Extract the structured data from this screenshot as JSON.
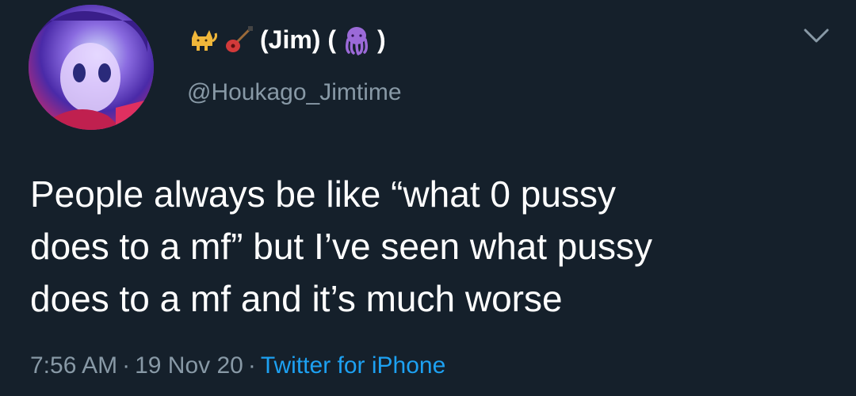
{
  "user": {
    "display_name_emojis": [
      "cat-emoji",
      "guitar-emoji"
    ],
    "display_name_text": "(Jim) (",
    "display_name_suffix_emoji": "octopus-emoji",
    "display_name_close": ")",
    "handle": "@Houkago_Jimtime"
  },
  "tweet": {
    "lines": [
      "People always be like “what 0 pussy",
      "does to a mf” but I’ve seen what pussy",
      "does to a mf and it’s much worse"
    ]
  },
  "meta": {
    "time": "7:56 AM",
    "separator": "·",
    "date": "19 Nov 20",
    "source": "Twitter for iPhone"
  },
  "colors": {
    "background": "#15202b",
    "text": "#ffffff",
    "secondary": "#8899a6",
    "link": "#1da1f2"
  },
  "icons": {
    "menu": "chevron-down-icon"
  }
}
